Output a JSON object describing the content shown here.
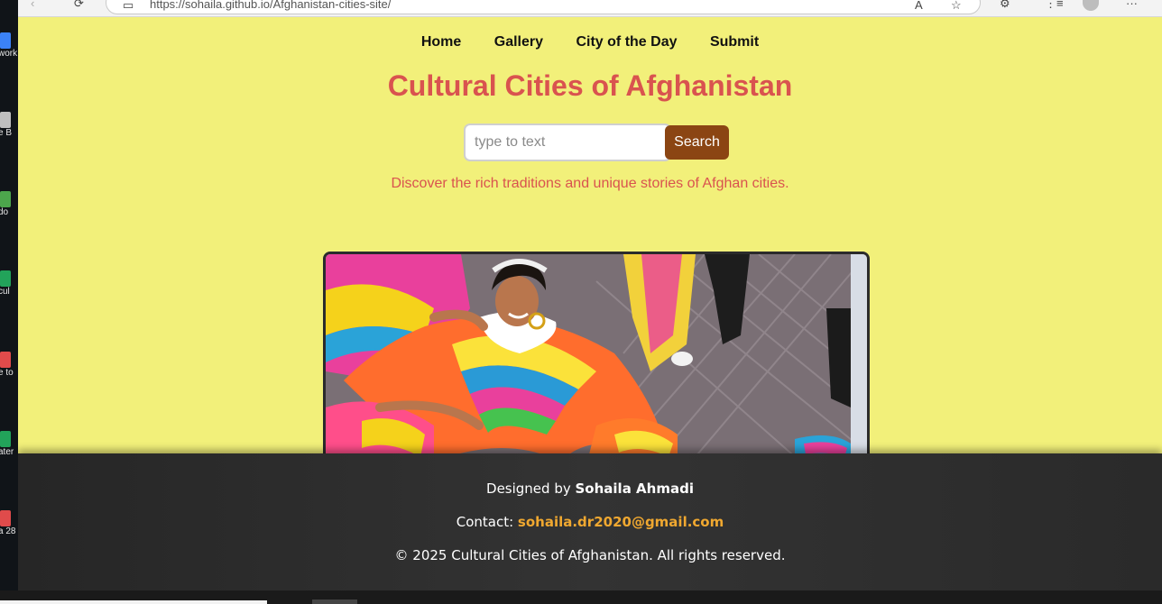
{
  "browser": {
    "url": "https://sohaila.github.io/Afghanistan-cities-site/"
  },
  "desktop": {
    "icons": [
      {
        "label": "work",
        "color": "#3b82f6"
      },
      {
        "label": "e B",
        "color": "#bfbfbf"
      },
      {
        "label": "do",
        "color": "#4ca64c"
      },
      {
        "label": "cul",
        "color": "#22a35a"
      },
      {
        "label": "e to",
        "color": "#e04b4b"
      },
      {
        "label": "ater",
        "color": "#22a35a"
      },
      {
        "label": "a 28",
        "color": "#e04b4b"
      }
    ]
  },
  "nav": {
    "home": "Home",
    "gallery": "Gallery",
    "city_of_day": "City of the Day",
    "submit": "Submit"
  },
  "header": {
    "title": "Cultural Cities of Afghanistan"
  },
  "search": {
    "placeholder": "type to text",
    "button": "Search"
  },
  "tagline": "Discover the rich traditions and unique stories of Afghan cities.",
  "footer": {
    "designed_prefix": "Designed by ",
    "designer": "Sohaila Ahmadi",
    "contact_prefix": "Contact: ",
    "email": "sohaila.dr2020@gmail.com",
    "copyright": "© 2025 Cultural Cities of Afghanistan. All rights reserved."
  },
  "colors": {
    "page_bg": "#f2f07a",
    "title": "#d9534f",
    "search_button": "#8b4513",
    "footer_bg": "#2e2e2e",
    "email": "#f0a830"
  },
  "icons": [
    "back-icon",
    "refresh-icon",
    "site-info-icon",
    "read-aloud-icon",
    "favorite-star-icon",
    "extensions-icon",
    "collections-icon",
    "profile-icon",
    "more-icon"
  ]
}
